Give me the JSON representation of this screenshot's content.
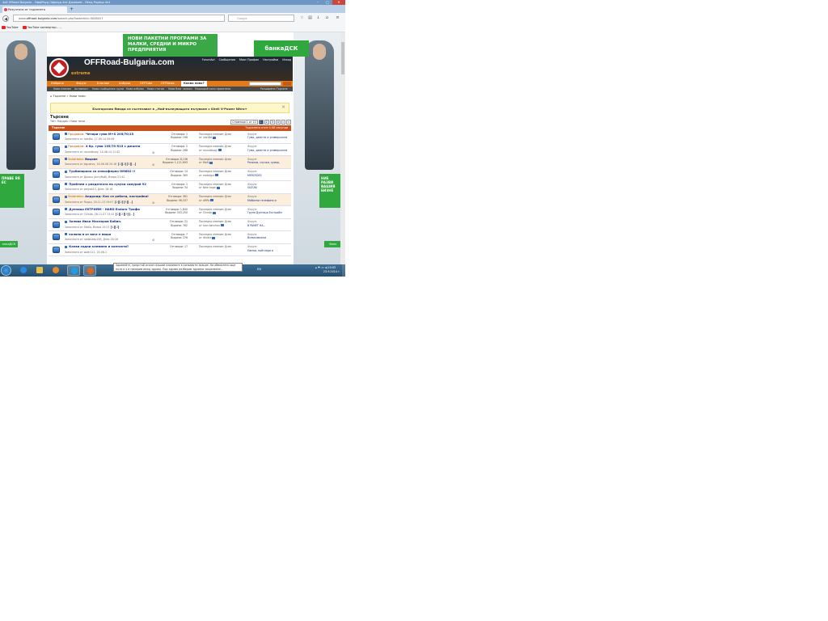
{
  "window": {
    "title": "4x4 Offroad Bulgaria - ОффРоуд Офроуд 4x4 Джипове - Ленд Роувър 4x4",
    "tab_title": "Резултати от търсенето",
    "url_prefix": "www.",
    "url_domain": "offroad-bulgaria.com",
    "url_path": "/search.php?searchid=3026017",
    "search_placeholder": "Google"
  },
  "bookmarks": [
    "YouTube",
    "YouTube конвертор - ..."
  ],
  "ads": {
    "top_banner": "НОВИ ПАКЕТНИ ПРОГРАМИ ЗА МАЛКИ, СРЕДНИ И МИКРО ПРЕДПРИЯТИЯ",
    "bank": "банкаДСК",
    "left_box": "ПРАВЕ ЯЯ ЕС",
    "right_box": "НИЕ РАЗВИ ВАШИЯ БИЗНЕ",
    "left_bank": "анкаДСК",
    "right_bank": "банк"
  },
  "forum": {
    "site_name": "OFFRoad-Bulgaria.com",
    "tagline": "extreme",
    "top_links": [
      "ForumAvi",
      "Сообщения",
      "Моят Профил",
      "Настройки",
      "Изход"
    ],
    "nav": [
      "Избрано",
      "Форум",
      "Блогове",
      "Албуми",
      "OFFTube",
      "OFFNews",
      "Какво ново?"
    ],
    "subnav": [
      "Нови мнения",
      "Активност",
      "Нови съобщения групи",
      "Нови албуми",
      "Нови статии",
      "Нови блог записи",
      "Маркирай като прочетено"
    ],
    "subnav_right": "Разширено Търсене",
    "breadcrumb": [
      "Търсене",
      "Нови теми"
    ],
    "notice": "Българския Ямоди се състезават в „Най-вълнуващото пътуване с Shell V-Power Nitro+",
    "page_title": "Търсене",
    "page_subtitle": "Тип: Нардик: Нови теми",
    "pager": {
      "label": "Страница 1 от 10",
      "pages": [
        "1",
        "2",
        "3",
        "4"
      ],
      "current": "1",
      "next": "›",
      "last": "»"
    },
    "table_header_left": "Търсене",
    "table_header_right": "Търсенето отне 0.08 секунди"
  },
  "threads": [
    {
      "prefix": "Продавам:",
      "title": "Четири гуми M+S 205/70/15",
      "by": "Започната от ivanBd, 17-09-14 09:06",
      "pages": [],
      "attach": false,
      "replies": "Отговори: 1",
      "views": "Видяни: 196",
      "last1": "Последно мнение: Днес",
      "last2": "от ivanBd",
      "forum_label": "Форум:",
      "forum": "Гуми, джанти и универсални",
      "sticky": false
    },
    {
      "prefix": "Продавам:",
      "title": "4 бр. гуми 195/70 R15 с джанти",
      "by": "Започната от noundbuay, 14-08-14 11:42",
      "pages": [],
      "attach": true,
      "replies": "Отговори: 2",
      "views": "Видяни: 268",
      "last1": "Последно мнение: Днес",
      "last2": "от noundbuay",
      "forum_label": "Форум:",
      "forum": "Гуми, джанти и универсални",
      "sticky": false
    },
    {
      "prefix": "Залепена:",
      "title": "Вицове",
      "by": "Започната от jaguarov, 16-06-08 20:18",
      "pages": [
        "1",
        "2",
        "3",
        "..."
      ],
      "attach": true,
      "replies": "Отговори: 8,136",
      "views": "Видяни: 1,121,693",
      "last1": "Последно мнение: Днес",
      "last2": "от Wolli",
      "forum_label": "Форум:",
      "forum": "Разкази, случки, хумор,",
      "sticky": true
    },
    {
      "prefix": "",
      "title": "Турбинирано за атмосферен ОМ602 !!",
      "by": "Започната от Джоси (Ахтубой), Вчера 21:42",
      "pages": [],
      "attach": false,
      "replies": "Отговори: 14",
      "views": "Видяни: 365",
      "last1": "Последно мнение: Днес",
      "last2": "от metalgur",
      "forum_label": "Форум:",
      "forum": "MERCEDES",
      "sticky": false
    },
    {
      "prefix": "",
      "title": "Проблем с раздатката на сузуки самурай 92",
      "by": "Започната от petyo413, Днес 18:16",
      "pages": [],
      "attach": false,
      "replies": "Отговори: 1",
      "views": "Видяни: 34",
      "last1": "Последно мнение: Днес",
      "last2": "от New hope",
      "forum_label": "Форум:",
      "forum": "SUZUKI",
      "sticky": false
    },
    {
      "prefix": "Залепена:",
      "title": "Андроид: Как се работи, настройки!",
      "by": "Започната от Радко, 20-11-13 19:07",
      "pages": [
        "1",
        "2",
        "3",
        "..."
      ],
      "attach": true,
      "replies": "Отговори: 361",
      "views": "Видяни: 56,337",
      "last1": "Последно мнение: Днес",
      "last2": "от oMPo",
      "forum_label": "Форум:",
      "forum": "Мобилни телефони и",
      "sticky": true
    },
    {
      "prefix": "",
      "title": "Дупница EKTPИЙМ - HARD Enduro Трофи",
      "by": "Започната от Chinda, 28-11-07 13:41",
      "pages": [
        "1",
        "2",
        "3",
        "..."
      ],
      "attach": false,
      "replies": "Отговори: 1,840",
      "views": "Видяни: 343,250",
      "last1": "Последно мнение: Днес",
      "last2": "от Chinda",
      "forum_label": "Форум:",
      "forum": "Група Дупница Екстрийм",
      "sticky": false
    },
    {
      "prefix": "",
      "title": "Залива Иван Масларов Бабин.",
      "by": "Започната от Sibiilo, Вчера 15:27",
      "pages": [
        "1",
        "2"
      ],
      "attach": false,
      "replies": "Отговори: 21",
      "views": "Видяни: 762",
      "last1": "Последно мнение: Днес",
      "last2": "от Ivan kanchov",
      "forum_label": "Форум:",
      "forum": "В PAMET НА...",
      "sticky": false
    },
    {
      "prefix": "",
      "title": "коляни в от вога е ниша",
      "by": "Започната от nadsnadp136, Днес 00:16",
      "pages": [],
      "attach": true,
      "replies": "Отговори: 7",
      "views": "Видяни: 276",
      "last1": "Последно мнение: Днес",
      "last2": "от dhrdre",
      "forum_label": "Форум:",
      "forum": "Всевъзможни",
      "sticky": false
    },
    {
      "prefix": "",
      "title": "Какви задни клеммен и контакти?",
      "by": "Започната от wadr111, 20-08-1",
      "pages": [],
      "attach": false,
      "replies": "Отговори: 17",
      "views": "",
      "last1": "Последно мнение: Днес",
      "last2": "",
      "forum_label": "Форум:",
      "forum": "Лампи, найтлери и",
      "sticky": false
    }
  ],
  "tooltip": "Здравейте, предстой искам скашим клонивате в конкавятм акацие. Ни обмислени още пъти и я и намерим вежд здраво. Под здраво разберим здравни закрепване...",
  "taskbar": {
    "lang": "EN",
    "time": "10:05",
    "date": "23.9.2014 г."
  }
}
